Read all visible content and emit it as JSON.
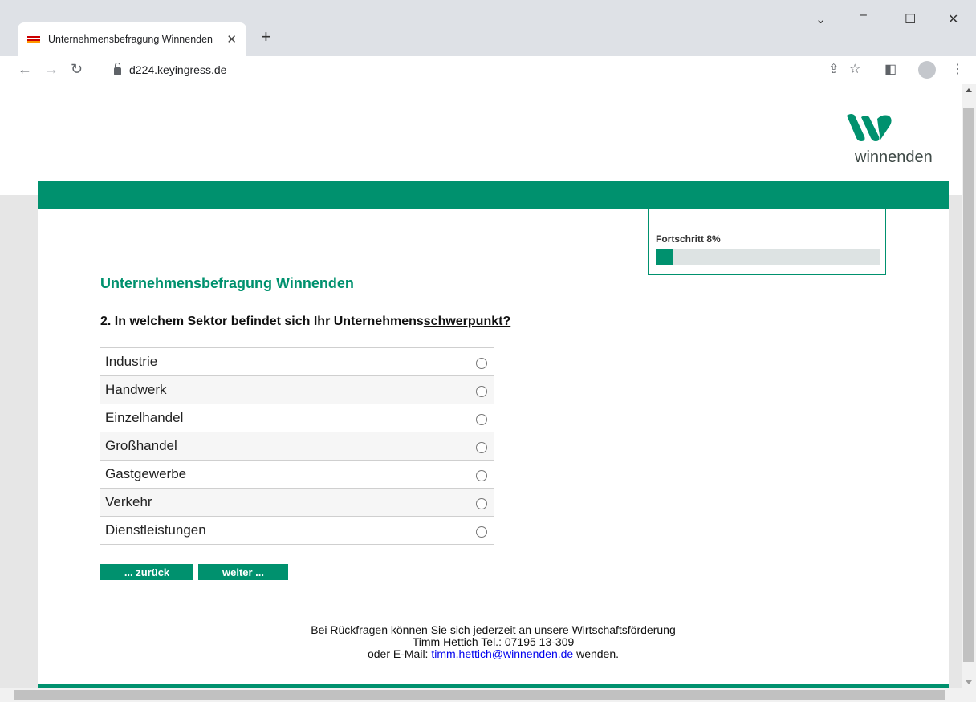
{
  "browser": {
    "tab_title": "Unternehmensbefragung Winnenden",
    "url": "d224.keyingress.de",
    "icons": [
      "favicon-flag-icon",
      "close-icon",
      "new-tab-icon",
      "back-icon",
      "forward-icon",
      "reload-icon",
      "lock-icon",
      "share-icon",
      "star-icon",
      "side-panel-icon",
      "profile-icon",
      "menu-icon",
      "minimize-icon",
      "maximize-icon",
      "close-window-icon",
      "tab-search-icon"
    ]
  },
  "logo": {
    "text": "winnenden",
    "color": "#00916e"
  },
  "progress": {
    "label": "Fortschritt 8%",
    "fraction": 0.08
  },
  "survey": {
    "title": "Unternehmensbefragung Winnenden",
    "question_prefix": "2. In welchem Sektor befindet sich Ihr Unternehmens",
    "question_underlined": "schwerpunkt?",
    "options": [
      "Industrie",
      "Handwerk",
      "Einzelhandel",
      "Großhandel",
      "Gastgewerbe",
      "Verkehr",
      "Dienstleistungen"
    ]
  },
  "buttons": {
    "back": "... zurück",
    "next": "weiter ..."
  },
  "footer": {
    "line1": "Bei Rückfragen können Sie sich jederzeit an unsere Wirtschaftsförderung",
    "line2": "Timm Hettich Tel.: 07195 13-309",
    "line3_prefix": "oder E-Mail: ",
    "email": "timm.hettich@winnenden.de",
    "line3_suffix": " wenden."
  },
  "colors": {
    "accent": "#00916e",
    "track": "#dde3e3"
  }
}
